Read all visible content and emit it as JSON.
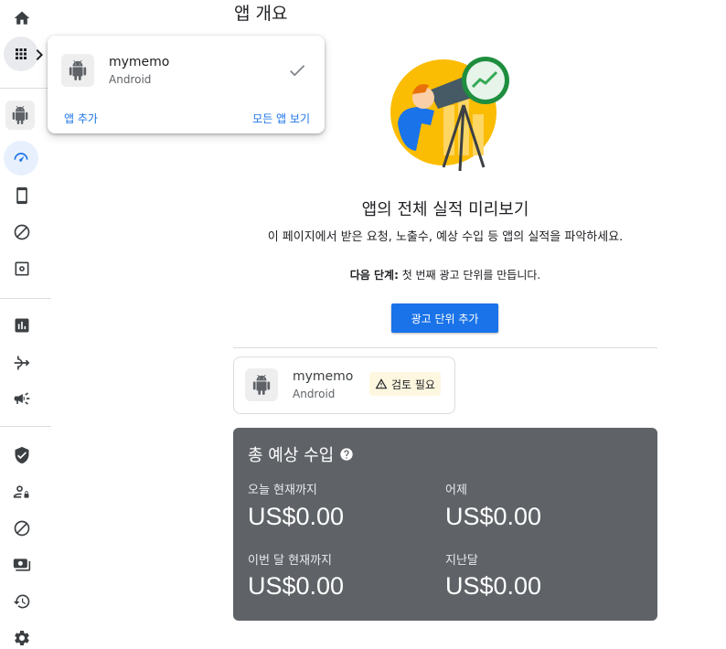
{
  "page": {
    "title": "앱 개요"
  },
  "popup": {
    "app_name": "mymemo",
    "app_platform": "Android",
    "add_app": "앱 추가",
    "view_all": "모든 앱 보기"
  },
  "empty_state": {
    "title": "앱의 전체 실적 미리보기",
    "description": "이 페이지에서 받은 요청, 노출수, 예상 수입 등 앱의 실적을 파악하세요.",
    "next_step_label": "다음 단계:",
    "next_step_text": " 첫 번째 광고 단위를 만듭니다.",
    "add_ad_unit_button": "광고 단위 추가"
  },
  "app_card": {
    "name": "mymemo",
    "platform": "Android",
    "badge": "검토 필요"
  },
  "earnings": {
    "title": "총 예상 수입",
    "today_label": "오늘 현재까지",
    "today_value": "US$0.00",
    "yesterday_label": "어제",
    "yesterday_value": "US$0.00",
    "this_month_label": "이번 달 현재까지",
    "this_month_value": "US$0.00",
    "last_month_label": "지난달",
    "last_month_value": "US$0.00"
  },
  "rail_icons": [
    "home-icon",
    "apps-grid-icon",
    "android-icon",
    "dashboard-icon",
    "phone-icon",
    "block-icon",
    "settings-box-icon",
    "bar-chart-icon",
    "mediation-icon",
    "campaign-icon",
    "policy-shield-icon",
    "privacy-user-icon",
    "block-icon-2",
    "payments-icon",
    "history-icon",
    "settings-icon"
  ],
  "colors": {
    "accent": "#1a73e8",
    "card_dark": "#5f6368",
    "badge_bg": "#fef7e0"
  }
}
